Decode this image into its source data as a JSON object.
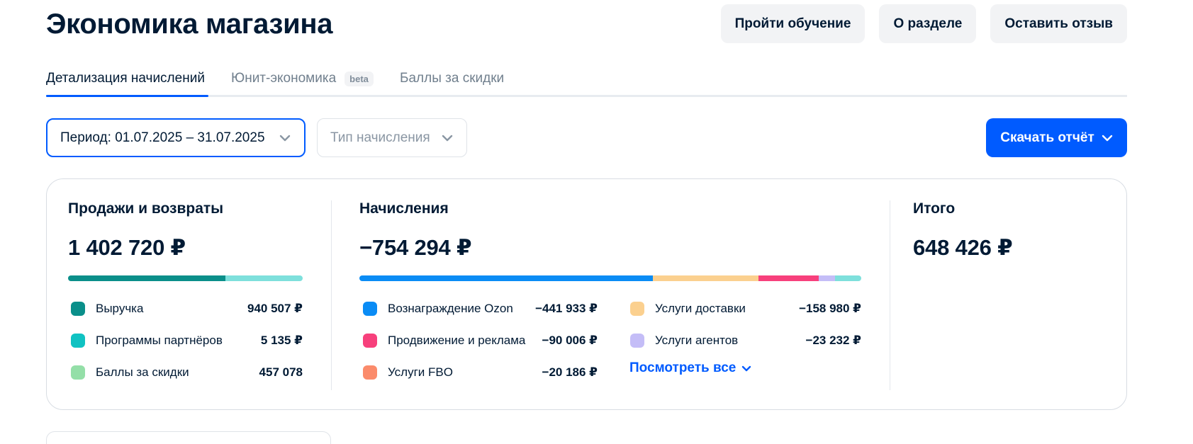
{
  "header": {
    "title": "Экономика магазина",
    "buttons": {
      "tutorial": "Пройти обучение",
      "about": "О разделе",
      "feedback": "Оставить отзыв"
    }
  },
  "tabs": [
    {
      "label": "Детализация начислений",
      "active": true
    },
    {
      "label": "Юнит-экономика",
      "badge": "beta",
      "active": false
    },
    {
      "label": "Баллы за скидки",
      "active": false
    }
  ],
  "filters": {
    "period": "Период: 01.07.2025 – 31.07.2025",
    "type": "Тип начисления"
  },
  "download_label": "Скачать отчёт",
  "summary": {
    "sales": {
      "title": "Продажи и возвраты",
      "amount": "1 402 720 ₽",
      "items": [
        {
          "label": "Выручка",
          "value": "940 507 ₽",
          "color": "#0a8f8a"
        },
        {
          "label": "Программы партнёров",
          "value": "5 135 ₽",
          "color": "#10c2c2"
        },
        {
          "label": "Баллы за скидки",
          "value": "457 078",
          "color": "#94dfa8"
        }
      ],
      "bar": [
        {
          "share": 0.67,
          "color": "#0a8f8a"
        },
        {
          "share": 0.33,
          "color": "#7ee0dc"
        }
      ]
    },
    "charges": {
      "title": "Начисления",
      "amount": "−754 294 ₽",
      "items": [
        {
          "label": "Вознаграждение Ozon",
          "value": "−441 933 ₽",
          "color": "#0a8cf5"
        },
        {
          "label": "Продвижение и реклама",
          "value": "−90 006 ₽",
          "color": "#f7407c"
        },
        {
          "label": "Услуги FBO",
          "value": "−20 186 ₽",
          "color": "#fb8b6b"
        },
        {
          "label": "Услуги доставки",
          "value": "−158 980 ₽",
          "color": "#fbd08f"
        },
        {
          "label": "Услуги агентов",
          "value": "−23 232 ₽",
          "color": "#c4bdf7"
        }
      ],
      "see_all": "Посмотреть все",
      "bar": [
        {
          "share": 0.585,
          "color": "#0a8cf5"
        },
        {
          "share": 0.21,
          "color": "#fbd08f"
        },
        {
          "share": 0.12,
          "color": "#f7407c"
        },
        {
          "share": 0.033,
          "color": "#c4bdf7"
        },
        {
          "share": 0.052,
          "color": "#7ee0dc"
        }
      ]
    },
    "total": {
      "title": "Итого",
      "amount": "648 426 ₽"
    }
  },
  "colors": {
    "accent": "#005bff",
    "text": "#001a34",
    "muted": "#707f8d"
  }
}
